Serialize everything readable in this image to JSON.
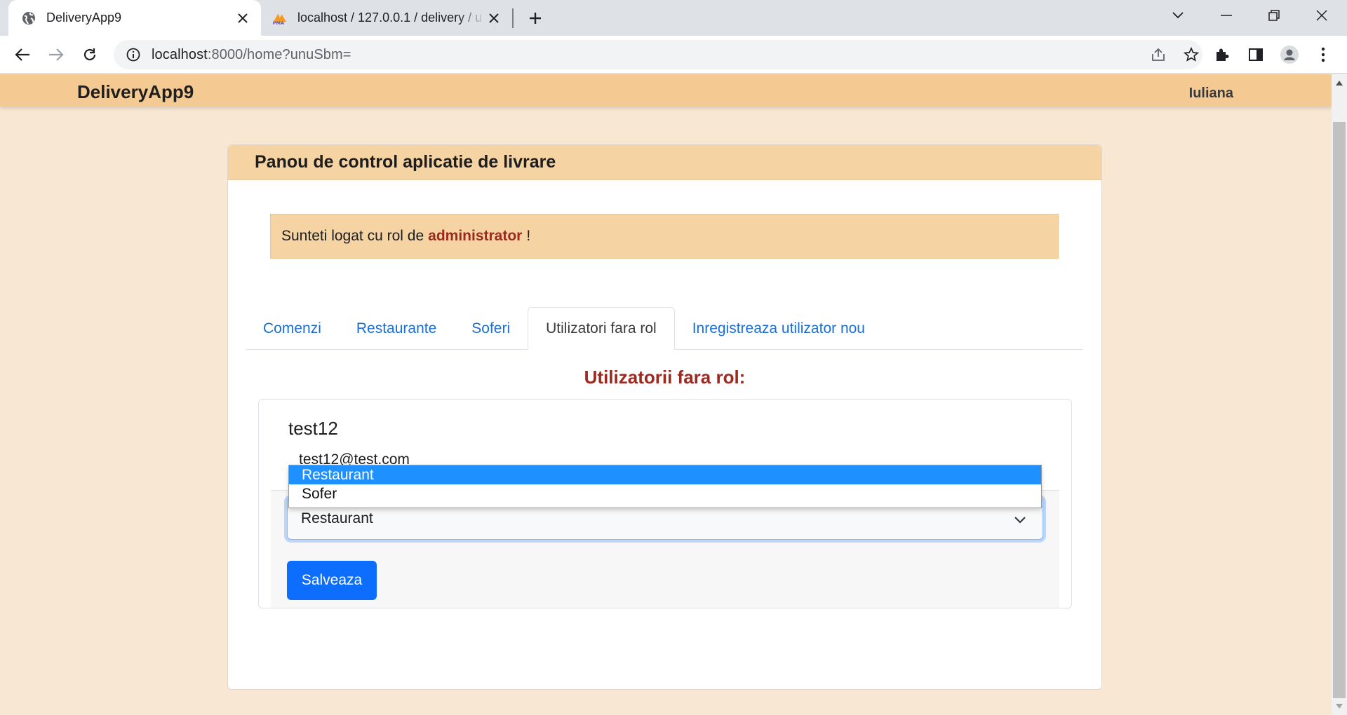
{
  "browser": {
    "tabs": [
      {
        "title": "DeliveryApp9",
        "icon": "globe-icon",
        "active": true
      },
      {
        "title": "localhost / 127.0.0.1 / delivery / u",
        "icon": "phpmyadmin-icon",
        "active": false
      }
    ],
    "url_host": "localhost",
    "url_path": ":8000/home?unuSbm="
  },
  "navbar": {
    "brand": "DeliveryApp9",
    "user": "Iuliana"
  },
  "panel": {
    "title": "Panou de control aplicatie de livrare",
    "alert_prefix": "Sunteti logat cu rol de",
    "alert_role": "administrator",
    "alert_suffix": "!"
  },
  "tabs": [
    {
      "label": "Comenzi",
      "active": false
    },
    {
      "label": "Restaurante",
      "active": false
    },
    {
      "label": "Soferi",
      "active": false
    },
    {
      "label": "Utilizatori fara rol",
      "active": true
    },
    {
      "label": "Inregistreaza utilizator nou",
      "active": false
    }
  ],
  "section_title": "Utilizatorii fara rol:",
  "user": {
    "name": "test12",
    "email": "test12@test.com",
    "role_select": {
      "selected": "Restaurant",
      "options": [
        "Restaurant",
        "Sofer"
      ]
    },
    "save_label": "Salveaza"
  },
  "colors": {
    "navbar": "#f5c992",
    "page_bg": "#f8e8d3",
    "accent_red": "#9b2a20",
    "link_blue": "#1a6fd6",
    "primary_button": "#0d6efd"
  }
}
